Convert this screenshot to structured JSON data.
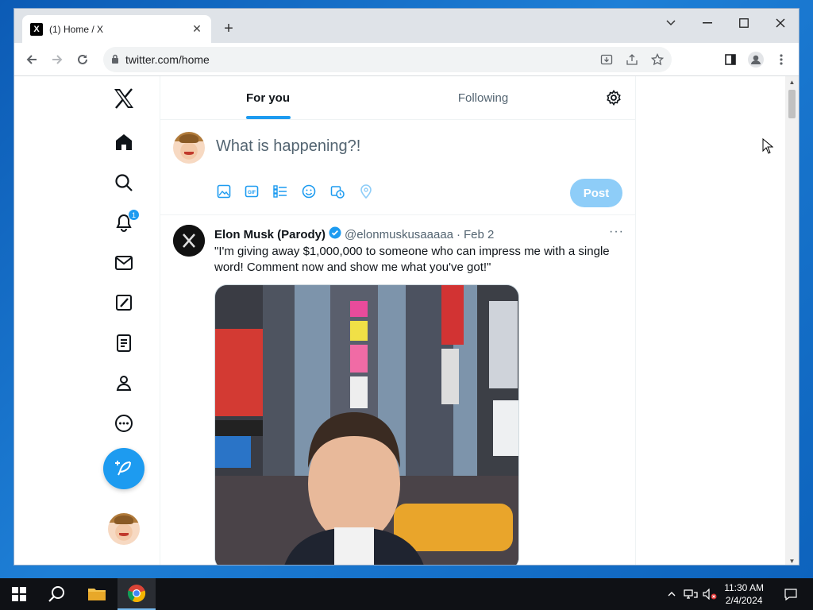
{
  "browser": {
    "tab_title": "(1) Home / X",
    "favicon_letter": "X",
    "url": "twitter.com/home"
  },
  "nav": {
    "items": [
      {
        "name": "x-logo-icon"
      },
      {
        "name": "home-icon"
      },
      {
        "name": "search-icon"
      },
      {
        "name": "notifications-icon",
        "badge": "1"
      },
      {
        "name": "messages-icon"
      },
      {
        "name": "grok-icon"
      },
      {
        "name": "lists-icon"
      },
      {
        "name": "profile-icon"
      },
      {
        "name": "more-icon"
      }
    ]
  },
  "feed_tabs": {
    "for_you": "For you",
    "following": "Following"
  },
  "composer": {
    "placeholder": "What is happening?!",
    "post_label": "Post"
  },
  "tweet": {
    "display_name": "Elon Musk (Parody)",
    "handle": "@elonmuskusaaaaa",
    "separator": "·",
    "date": "Feb 2",
    "text": "\"I'm giving away $1,000,000 to someone who can impress me with a single word! Comment now and show me what you've got!\"",
    "more": "···"
  },
  "taskbar": {
    "time": "11:30 AM",
    "date": "2/4/2024"
  },
  "colors": {
    "accent": "#1d9bf0",
    "post_disabled": "#8ecdf8"
  }
}
